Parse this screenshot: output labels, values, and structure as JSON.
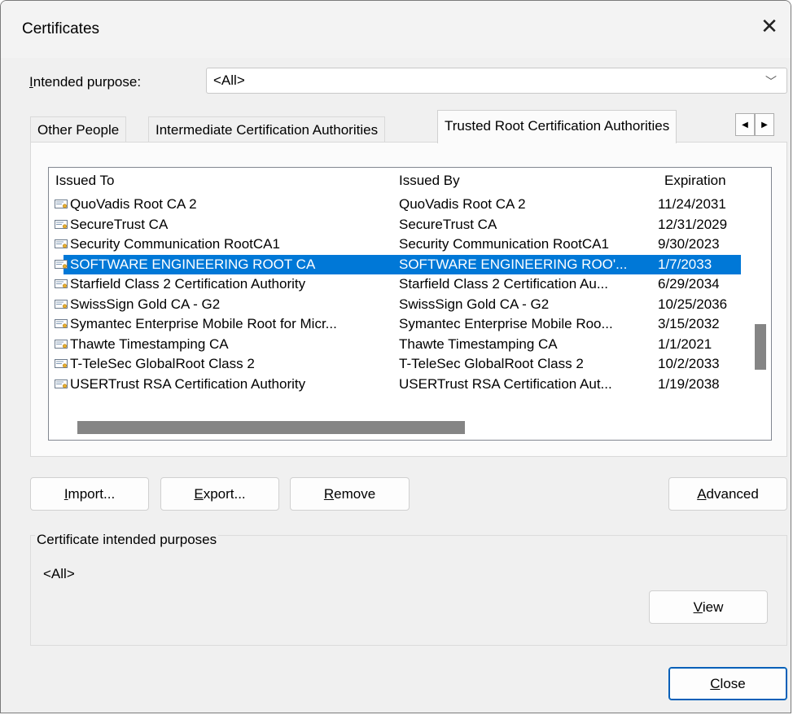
{
  "window": {
    "title": "Certificates"
  },
  "purpose": {
    "label_accel": "I",
    "label_rest": "ntended purpose:",
    "value": "<All>"
  },
  "tabs": [
    {
      "label": "Other People"
    },
    {
      "label": "Intermediate Certification Authorities"
    },
    {
      "label": "Trusted Root Certification Authorities"
    }
  ],
  "tab_scroll": {
    "left": "◀",
    "right": "▶"
  },
  "list": {
    "columns": [
      "Issued To",
      "Issued By",
      "Expiration"
    ],
    "rows": [
      {
        "to": "QuoVadis Root CA 2",
        "by": "QuoVadis Root CA 2",
        "exp": "11/24/2031"
      },
      {
        "to": "SecureTrust CA",
        "by": "SecureTrust CA",
        "exp": "12/31/2029"
      },
      {
        "to": "Security Communication RootCA1",
        "by": "Security Communication RootCA1",
        "exp": "9/30/2023"
      },
      {
        "to": "SOFTWARE ENGINEERING ROOT CA",
        "by": "SOFTWARE ENGINEERING ROO'...",
        "exp": "1/7/2033",
        "selected": true
      },
      {
        "to": "Starfield Class 2 Certification Authority",
        "by": "Starfield Class 2 Certification Au...",
        "exp": "6/29/2034"
      },
      {
        "to": "SwissSign Gold CA - G2",
        "by": "SwissSign Gold CA - G2",
        "exp": "10/25/2036"
      },
      {
        "to": "Symantec Enterprise Mobile Root for Micr...",
        "by": "Symantec Enterprise Mobile Roo...",
        "exp": "3/15/2032"
      },
      {
        "to": "Thawte Timestamping CA",
        "by": "Thawte Timestamping CA",
        "exp": "1/1/2021"
      },
      {
        "to": "T-TeleSec GlobalRoot Class 2",
        "by": "T-TeleSec GlobalRoot Class 2",
        "exp": "10/2/2033"
      },
      {
        "to": "USERTrust RSA Certification Authority",
        "by": "USERTrust RSA Certification Aut...",
        "exp": "1/19/2038"
      }
    ]
  },
  "buttons": {
    "import": {
      "accel": "I",
      "rest": "mport..."
    },
    "export": {
      "accel": "E",
      "rest": "xport..."
    },
    "remove": {
      "accel": "R",
      "rest": "emove"
    },
    "advanced": {
      "accel": "A",
      "rest": "dvanced"
    },
    "view": {
      "accel": "V",
      "rest": "iew"
    },
    "close": {
      "accel": "C",
      "rest": "lose"
    }
  },
  "purposes_group": {
    "legend": "Certificate intended purposes",
    "value": "<All>"
  },
  "icons": {
    "close": "close-icon",
    "dropdown": "chevron-down-icon",
    "cert": "certificate-icon"
  },
  "colors": {
    "selection": "#0078d7",
    "dialog_bg": "#f0f0f0",
    "default_button_border": "#005fb8"
  }
}
